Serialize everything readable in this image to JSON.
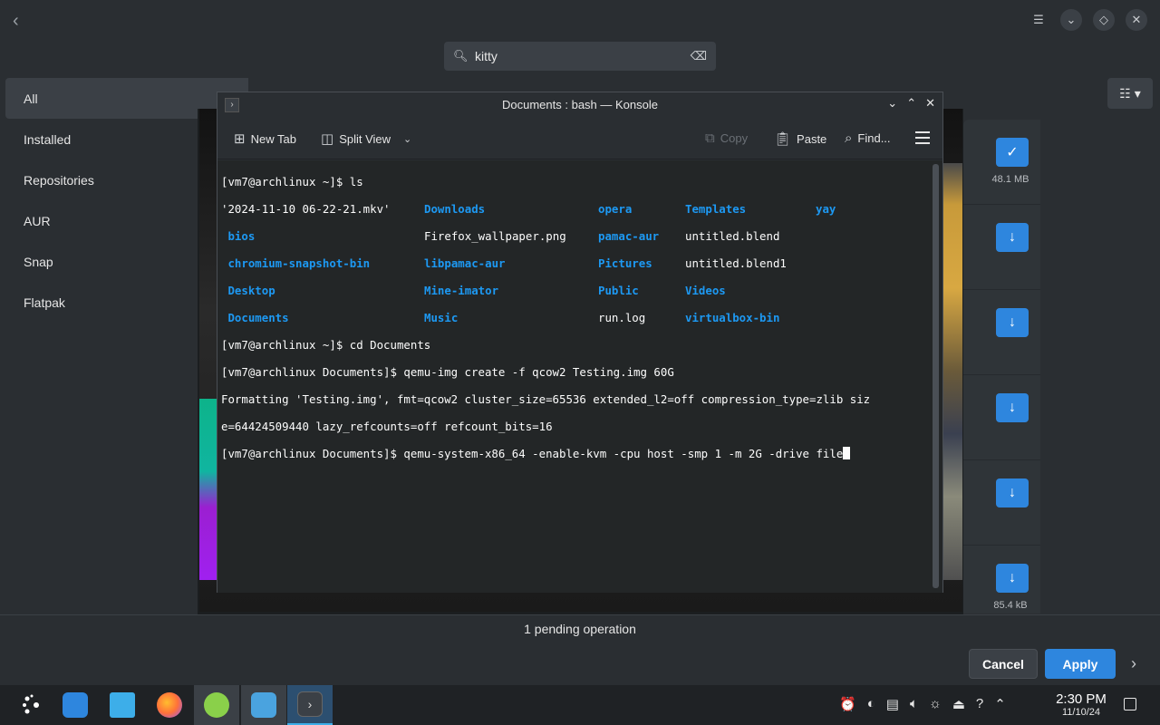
{
  "discover": {
    "search": {
      "value": "kitty"
    },
    "sidebar": {
      "items": [
        {
          "label": "All"
        },
        {
          "label": "Installed"
        },
        {
          "label": "Repositories"
        },
        {
          "label": "AUR"
        },
        {
          "label": "Snap"
        },
        {
          "label": "Flatpak"
        }
      ]
    },
    "results": [
      {
        "status": "installed",
        "size": "48.1 MB"
      },
      {
        "status": "download",
        "size": ""
      },
      {
        "status": "download",
        "size": ""
      },
      {
        "status": "download",
        "size": ""
      },
      {
        "status": "download",
        "size": ""
      },
      {
        "status": "download",
        "size": "85.4 kB"
      }
    ],
    "pending": "1 pending operation",
    "cancel_label": "Cancel",
    "apply_label": "Apply"
  },
  "konsole": {
    "title": "Documents : bash — Konsole",
    "toolbar": {
      "new_tab": "New Tab",
      "split_view": "Split View",
      "copy": "Copy",
      "paste": "Paste",
      "find": "Find..."
    },
    "terminal": {
      "prompt_home": "[vm7@archlinux ~]$ ",
      "prompt_docs": "[vm7@archlinux Documents]$ ",
      "cmd_ls": "ls",
      "ls_rows": [
        [
          "'2024-11-10 06-22-21.mkv'",
          "Downloads",
          "opera",
          "Templates",
          "yay"
        ],
        [
          " bios",
          "Firefox_wallpaper.png",
          "pamac-aur",
          "untitled.blend",
          ""
        ],
        [
          " chromium-snapshot-bin",
          "libpamac-aur",
          "Pictures",
          "untitled.blend1",
          ""
        ],
        [
          " Desktop",
          "Mine-imator",
          "Public",
          "Videos",
          ""
        ],
        [
          " Documents",
          "Music",
          "run.log",
          "virtualbox-bin",
          ""
        ]
      ],
      "cmd_cd": "cd Documents",
      "cmd_qemu_img": "qemu-img create -f qcow2 Testing.img 60G",
      "output_1": "Formatting 'Testing.img', fmt=qcow2 cluster_size=65536 extended_l2=off compression_type=zlib siz",
      "output_2": "e=64424509440 lazy_refcounts=off refcount_bits=16",
      "cmd_current": "qemu-system-x86_64 -enable-kvm -cpu host -smp 1 -m 2G -drive file"
    }
  },
  "taskbar": {
    "time": "2:30 PM",
    "date": "11/10/24"
  },
  "colors": {
    "accent": "#2e86de",
    "dir_blue": "#1d99f3",
    "terminal_bg": "#232627"
  }
}
